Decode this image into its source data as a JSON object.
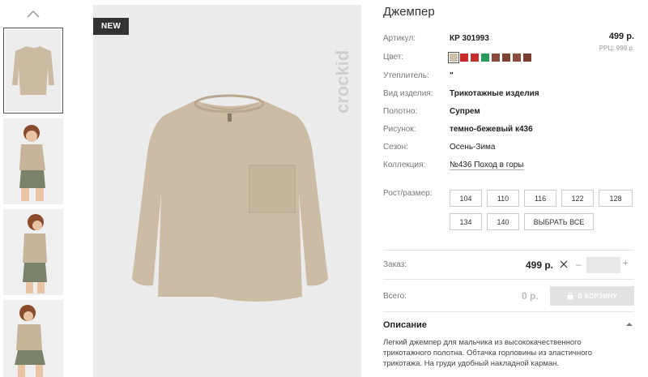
{
  "product": {
    "title": "Джемпер",
    "badge": "NEW",
    "brand": "crockid",
    "price": "499 р.",
    "rrp": "РРЦ: 999 р."
  },
  "thumbnails": [
    {
      "alt": "jumper flat",
      "active": true
    },
    {
      "alt": "model front",
      "active": false
    },
    {
      "alt": "model side",
      "active": false
    },
    {
      "alt": "model seated",
      "active": false
    }
  ],
  "specs": [
    {
      "key": "Артикул:",
      "value": "КР 301993"
    },
    {
      "key": "Цвет:",
      "value": ""
    },
    {
      "key": "Утеплитель:",
      "value": "\""
    },
    {
      "key": "Вид изделия:",
      "value": "Трикотажные изделия"
    },
    {
      "key": "Полотно:",
      "value": "Супрем"
    },
    {
      "key": "Рисунок:",
      "value": "темно-бежевый к436"
    },
    {
      "key": "Сезон:",
      "value": "Осень-Зима"
    },
    {
      "key": "Коллекция:",
      "value": "№436 Поход в горы"
    },
    {
      "key": "Рост/размер:",
      "value": ""
    }
  ],
  "colors": [
    "#cdbfa9",
    "#c62a2a",
    "#c43030",
    "#2e9a5a",
    "#8a4a3c",
    "#7c4433",
    "#8c4b3b",
    "#7a3f32",
    "#8e4e3f"
  ],
  "sizes": [
    "104",
    "110",
    "116",
    "122",
    "128",
    "134",
    "140",
    "ВЫБРАТЬ ВСЕ"
  ],
  "order": {
    "label": "Заказ:",
    "price": "499 р.",
    "minus": "–",
    "plus": "+",
    "qty": ""
  },
  "total": {
    "label": "Всего:",
    "value": "0 р.",
    "cart": "В КОРЗИНУ"
  },
  "description": {
    "title": "Описание",
    "text": "Легкий джемпер для мальчика из высококачественного трикотажного полотна. Обтачка горловины из эластичного трикотажа. На груди удобный накладной карман."
  }
}
